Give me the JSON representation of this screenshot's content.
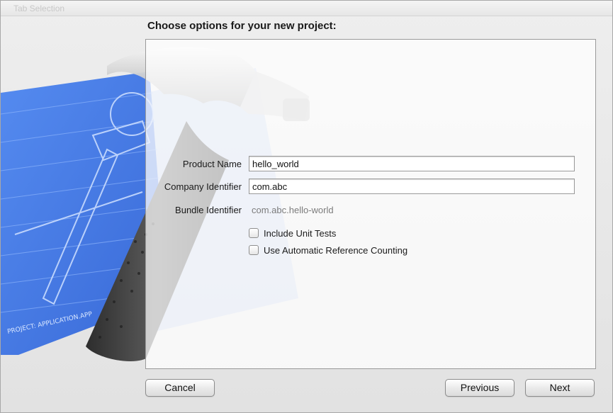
{
  "window": {
    "title": "Tab Selection"
  },
  "heading": "Choose options for your new project:",
  "form": {
    "product_name_label": "Product Name",
    "product_name_value": "hello_world",
    "company_identifier_label": "Company Identifier",
    "company_identifier_value": "com.abc",
    "bundle_identifier_label": "Bundle Identifier",
    "bundle_identifier_value": "com.abc.hello-world",
    "include_unit_tests_label": "Include Unit Tests",
    "include_unit_tests_checked": false,
    "use_arc_label": "Use Automatic Reference Counting",
    "use_arc_checked": false
  },
  "blueprint": {
    "caption": "PROJECT: APPLICATION.APP"
  },
  "buttons": {
    "cancel_label": "Cancel",
    "previous_label": "Previous",
    "next_label": "Next"
  },
  "colors": {
    "blueprint": "#3f78e6",
    "hammer_handle": "#4a4a4a",
    "hammer_head": "#d8d8d8"
  }
}
